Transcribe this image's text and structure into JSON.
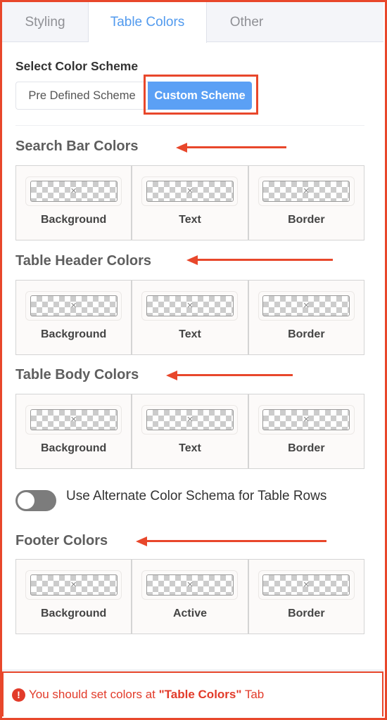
{
  "tabs": [
    {
      "label": "Styling",
      "active": false
    },
    {
      "label": "Table Colors",
      "active": true
    },
    {
      "label": "Other",
      "active": false
    }
  ],
  "scheme": {
    "label": "Select Color Scheme",
    "options": [
      "Pre Defined Scheme",
      "Custom Scheme"
    ],
    "selected": "Custom Scheme"
  },
  "sections": {
    "search_bar": {
      "title": "Search Bar Colors",
      "fields": [
        "Background",
        "Text",
        "Border"
      ]
    },
    "table_header": {
      "title": "Table Header Colors",
      "fields": [
        "Background",
        "Text",
        "Border"
      ]
    },
    "table_body": {
      "title": "Table Body Colors",
      "fields": [
        "Background",
        "Text",
        "Border"
      ]
    },
    "footer": {
      "title": "Footer Colors",
      "fields": [
        "Background",
        "Active",
        "Border"
      ]
    }
  },
  "alternate_toggle": {
    "label": "Use Alternate Color Schema for Table Rows",
    "enabled": false
  },
  "swatch_clear_glyph": "×",
  "notice": {
    "icon": "!",
    "prefix": "You should set colors at ",
    "emphasis": "\"Table Colors\"",
    "suffix": " Tab"
  },
  "colors": {
    "accent": "#519aee",
    "button_active": "#5ba0f5",
    "annotation_red": "#e8472b",
    "notice_red": "#e23b2a"
  }
}
